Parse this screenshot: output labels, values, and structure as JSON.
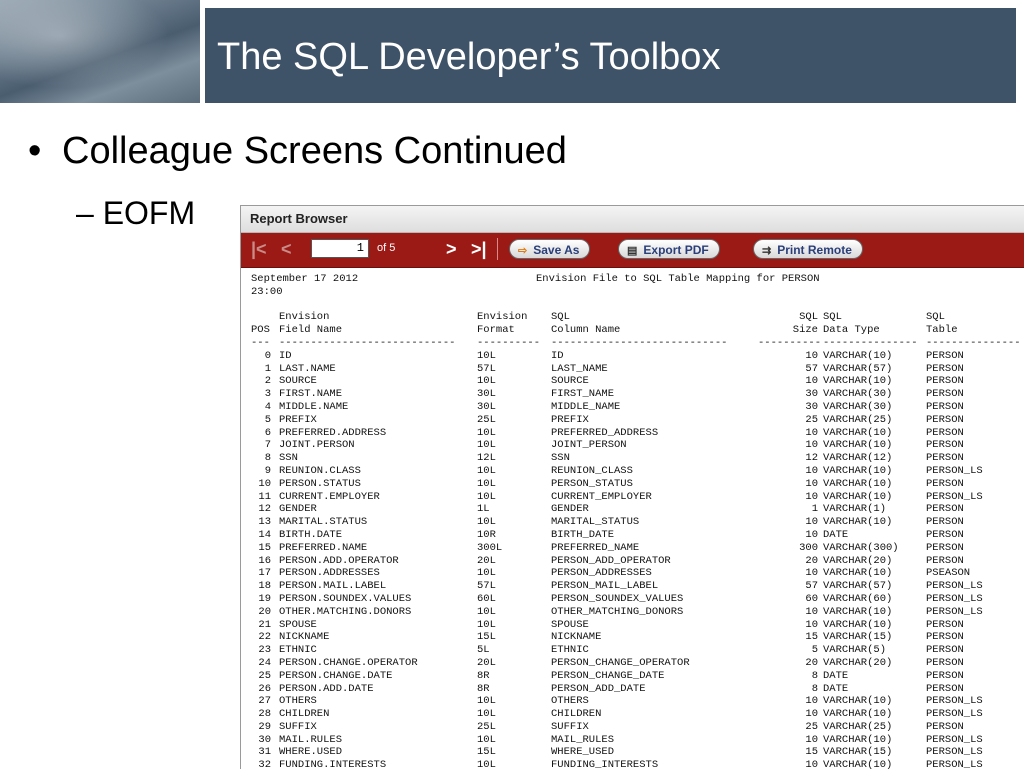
{
  "slide": {
    "title": "The SQL Developer’s Toolbox",
    "bullet1": "Colleague Screens Continued",
    "bullet2": "– EOFM"
  },
  "window": {
    "title": "Report Browser",
    "toolbar": {
      "first_icon": "|<",
      "prev_icon": "<",
      "page": "1",
      "page_of": "of 5",
      "next_icon": ">",
      "last_icon": ">|",
      "save_as": "Save As",
      "export_pdf": "Export PDF",
      "print_remote": "Print Remote"
    }
  },
  "report": {
    "date": "September 17 2012",
    "time": "23:00",
    "title": "Envision File to SQL Table Mapping for PERSON",
    "headers1": {
      "field": "Envision",
      "fmt": "Envision",
      "col": "SQL",
      "size": "SQL",
      "type": "SQL",
      "tbl": "SQL"
    },
    "headers2": {
      "pos": "POS",
      "field": "Field Name",
      "fmt": "Format",
      "col": "Column Name",
      "size": "Size",
      "type": "Data Type",
      "tbl": "Table"
    },
    "rows": [
      {
        "pos": "0",
        "field": "ID",
        "fmt": "10L",
        "col": "ID",
        "size": "10",
        "type": "VARCHAR(10)",
        "tbl": "PERSON"
      },
      {
        "pos": "1",
        "field": "LAST.NAME",
        "fmt": "57L",
        "col": "LAST_NAME",
        "size": "57",
        "type": "VARCHAR(57)",
        "tbl": "PERSON"
      },
      {
        "pos": "2",
        "field": "SOURCE",
        "fmt": "10L",
        "col": "SOURCE",
        "size": "10",
        "type": "VARCHAR(10)",
        "tbl": "PERSON"
      },
      {
        "pos": "3",
        "field": "FIRST.NAME",
        "fmt": "30L",
        "col": "FIRST_NAME",
        "size": "30",
        "type": "VARCHAR(30)",
        "tbl": "PERSON"
      },
      {
        "pos": "4",
        "field": "MIDDLE.NAME",
        "fmt": "30L",
        "col": "MIDDLE_NAME",
        "size": "30",
        "type": "VARCHAR(30)",
        "tbl": "PERSON"
      },
      {
        "pos": "5",
        "field": "PREFIX",
        "fmt": "25L",
        "col": "PREFIX",
        "size": "25",
        "type": "VARCHAR(25)",
        "tbl": "PERSON"
      },
      {
        "pos": "6",
        "field": "PREFERRED.ADDRESS",
        "fmt": "10L",
        "col": "PREFERRED_ADDRESS",
        "size": "10",
        "type": "VARCHAR(10)",
        "tbl": "PERSON"
      },
      {
        "pos": "7",
        "field": "JOINT.PERSON",
        "fmt": "10L",
        "col": "JOINT_PERSON",
        "size": "10",
        "type": "VARCHAR(10)",
        "tbl": "PERSON"
      },
      {
        "pos": "8",
        "field": "SSN",
        "fmt": "12L",
        "col": "SSN",
        "size": "12",
        "type": "VARCHAR(12)",
        "tbl": "PERSON"
      },
      {
        "pos": "9",
        "field": "REUNION.CLASS",
        "fmt": "10L",
        "col": "REUNION_CLASS",
        "size": "10",
        "type": "VARCHAR(10)",
        "tbl": "PERSON_LS"
      },
      {
        "pos": "10",
        "field": "PERSON.STATUS",
        "fmt": "10L",
        "col": "PERSON_STATUS",
        "size": "10",
        "type": "VARCHAR(10)",
        "tbl": "PERSON"
      },
      {
        "pos": "11",
        "field": "CURRENT.EMPLOYER",
        "fmt": "10L",
        "col": "CURRENT_EMPLOYER",
        "size": "10",
        "type": "VARCHAR(10)",
        "tbl": "PERSON_LS"
      },
      {
        "pos": "12",
        "field": "GENDER",
        "fmt": "1L",
        "col": "GENDER",
        "size": "1",
        "type": "VARCHAR(1)",
        "tbl": "PERSON"
      },
      {
        "pos": "13",
        "field": "MARITAL.STATUS",
        "fmt": "10L",
        "col": "MARITAL_STATUS",
        "size": "10",
        "type": "VARCHAR(10)",
        "tbl": "PERSON"
      },
      {
        "pos": "14",
        "field": "BIRTH.DATE",
        "fmt": "10R",
        "col": "BIRTH_DATE",
        "size": "10",
        "type": "DATE",
        "tbl": "PERSON"
      },
      {
        "pos": "15",
        "field": "PREFERRED.NAME",
        "fmt": "300L",
        "col": "PREFERRED_NAME",
        "size": "300",
        "type": "VARCHAR(300)",
        "tbl": "PERSON"
      },
      {
        "pos": "16",
        "field": "PERSON.ADD.OPERATOR",
        "fmt": "20L",
        "col": "PERSON_ADD_OPERATOR",
        "size": "20",
        "type": "VARCHAR(20)",
        "tbl": "PERSON"
      },
      {
        "pos": "17",
        "field": "PERSON.ADDRESSES",
        "fmt": "10L",
        "col": "PERSON_ADDRESSES",
        "size": "10",
        "type": "VARCHAR(10)",
        "tbl": "PSEASON"
      },
      {
        "pos": "18",
        "field": "PERSON.MAIL.LABEL",
        "fmt": "57L",
        "col": "PERSON_MAIL_LABEL",
        "size": "57",
        "type": "VARCHAR(57)",
        "tbl": "PERSON_LS"
      },
      {
        "pos": "19",
        "field": "PERSON.SOUNDEX.VALUES",
        "fmt": "60L",
        "col": "PERSON_SOUNDEX_VALUES",
        "size": "60",
        "type": "VARCHAR(60)",
        "tbl": "PERSON_LS"
      },
      {
        "pos": "20",
        "field": "OTHER.MATCHING.DONORS",
        "fmt": "10L",
        "col": "OTHER_MATCHING_DONORS",
        "size": "10",
        "type": "VARCHAR(10)",
        "tbl": "PERSON_LS"
      },
      {
        "pos": "21",
        "field": "SPOUSE",
        "fmt": "10L",
        "col": "SPOUSE",
        "size": "10",
        "type": "VARCHAR(10)",
        "tbl": "PERSON"
      },
      {
        "pos": "22",
        "field": "NICKNAME",
        "fmt": "15L",
        "col": "NICKNAME",
        "size": "15",
        "type": "VARCHAR(15)",
        "tbl": "PERSON"
      },
      {
        "pos": "23",
        "field": "ETHNIC",
        "fmt": "5L",
        "col": "ETHNIC",
        "size": "5",
        "type": "VARCHAR(5)",
        "tbl": "PERSON"
      },
      {
        "pos": "24",
        "field": "PERSON.CHANGE.OPERATOR",
        "fmt": "20L",
        "col": "PERSON_CHANGE_OPERATOR",
        "size": "20",
        "type": "VARCHAR(20)",
        "tbl": "PERSON"
      },
      {
        "pos": "25",
        "field": "PERSON.CHANGE.DATE",
        "fmt": "8R",
        "col": "PERSON_CHANGE_DATE",
        "size": "8",
        "type": "DATE",
        "tbl": "PERSON"
      },
      {
        "pos": "26",
        "field": "PERSON.ADD.DATE",
        "fmt": "8R",
        "col": "PERSON_ADD_DATE",
        "size": "8",
        "type": "DATE",
        "tbl": "PERSON"
      },
      {
        "pos": "27",
        "field": "OTHERS",
        "fmt": "10L",
        "col": "OTHERS",
        "size": "10",
        "type": "VARCHAR(10)",
        "tbl": "PERSON_LS"
      },
      {
        "pos": "28",
        "field": "CHILDREN",
        "fmt": "10L",
        "col": "CHILDREN",
        "size": "10",
        "type": "VARCHAR(10)",
        "tbl": "PERSON_LS"
      },
      {
        "pos": "29",
        "field": "SUFFIX",
        "fmt": "25L",
        "col": "SUFFIX",
        "size": "25",
        "type": "VARCHAR(25)",
        "tbl": "PERSON"
      },
      {
        "pos": "30",
        "field": "MAIL.RULES",
        "fmt": "10L",
        "col": "MAIL_RULES",
        "size": "10",
        "type": "VARCHAR(10)",
        "tbl": "PERSON_LS"
      },
      {
        "pos": "31",
        "field": "WHERE.USED",
        "fmt": "15L",
        "col": "WHERE_USED",
        "size": "15",
        "type": "VARCHAR(15)",
        "tbl": "PERSON_LS"
      },
      {
        "pos": "32",
        "field": "FUNDING.INTERESTS",
        "fmt": "10L",
        "col": "FUNDING_INTERESTS",
        "size": "10",
        "type": "VARCHAR(10)",
        "tbl": "PERSON_LS"
      }
    ]
  }
}
